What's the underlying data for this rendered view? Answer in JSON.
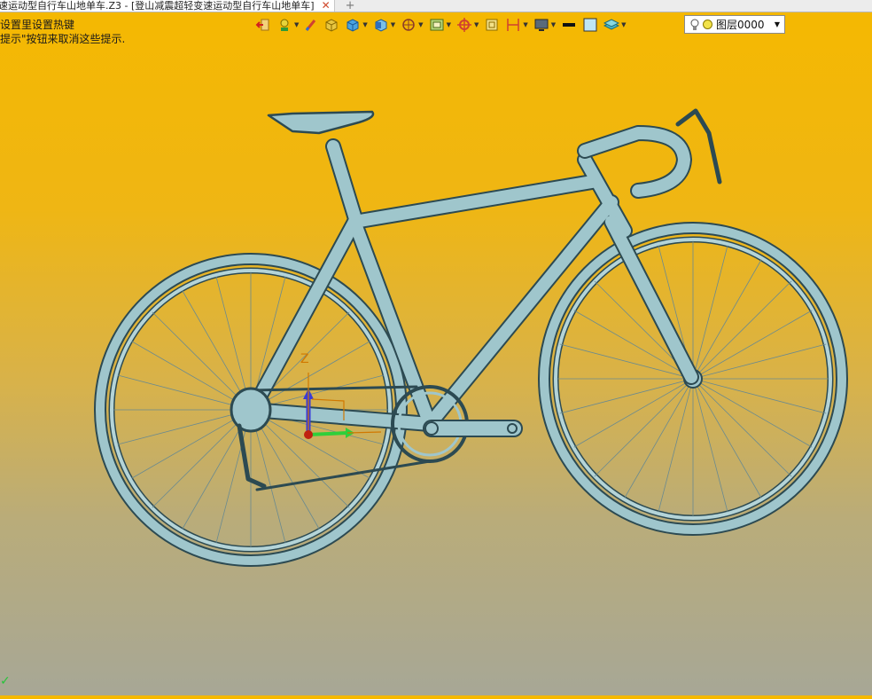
{
  "window": {
    "tab_title": "速运动型自行车山地单车.Z3 - [登山减震超轻变速运动型自行车山地单车]",
    "close_glyph": "✕",
    "new_tab_glyph": "+"
  },
  "hints": {
    "line1": "设置里设置热键",
    "line2": "提示\"按钮来取消这些提示."
  },
  "toolbar": {
    "icons": [
      "exit-icon",
      "light-icon",
      "edit-icon",
      "box-icon",
      "cube-icon",
      "view-cube-icon",
      "snap-icon",
      "shade-icon",
      "axis-icon",
      "frame-icon",
      "dimension-icon",
      "display-icon",
      "line-color-icon",
      "fill-color-icon",
      "layer-plane-icon"
    ],
    "layer": {
      "value": "图层0000"
    }
  },
  "viewport": {
    "axis_label": "Z",
    "model": "bicycle"
  },
  "colors": {
    "background_top": "#f5b800",
    "background_bottom": "#a7a796",
    "model": "#9fc6cc",
    "axis_z": "#3b3bd6",
    "axis_x": "#2fcf3a",
    "axis_label": "#d07800"
  }
}
